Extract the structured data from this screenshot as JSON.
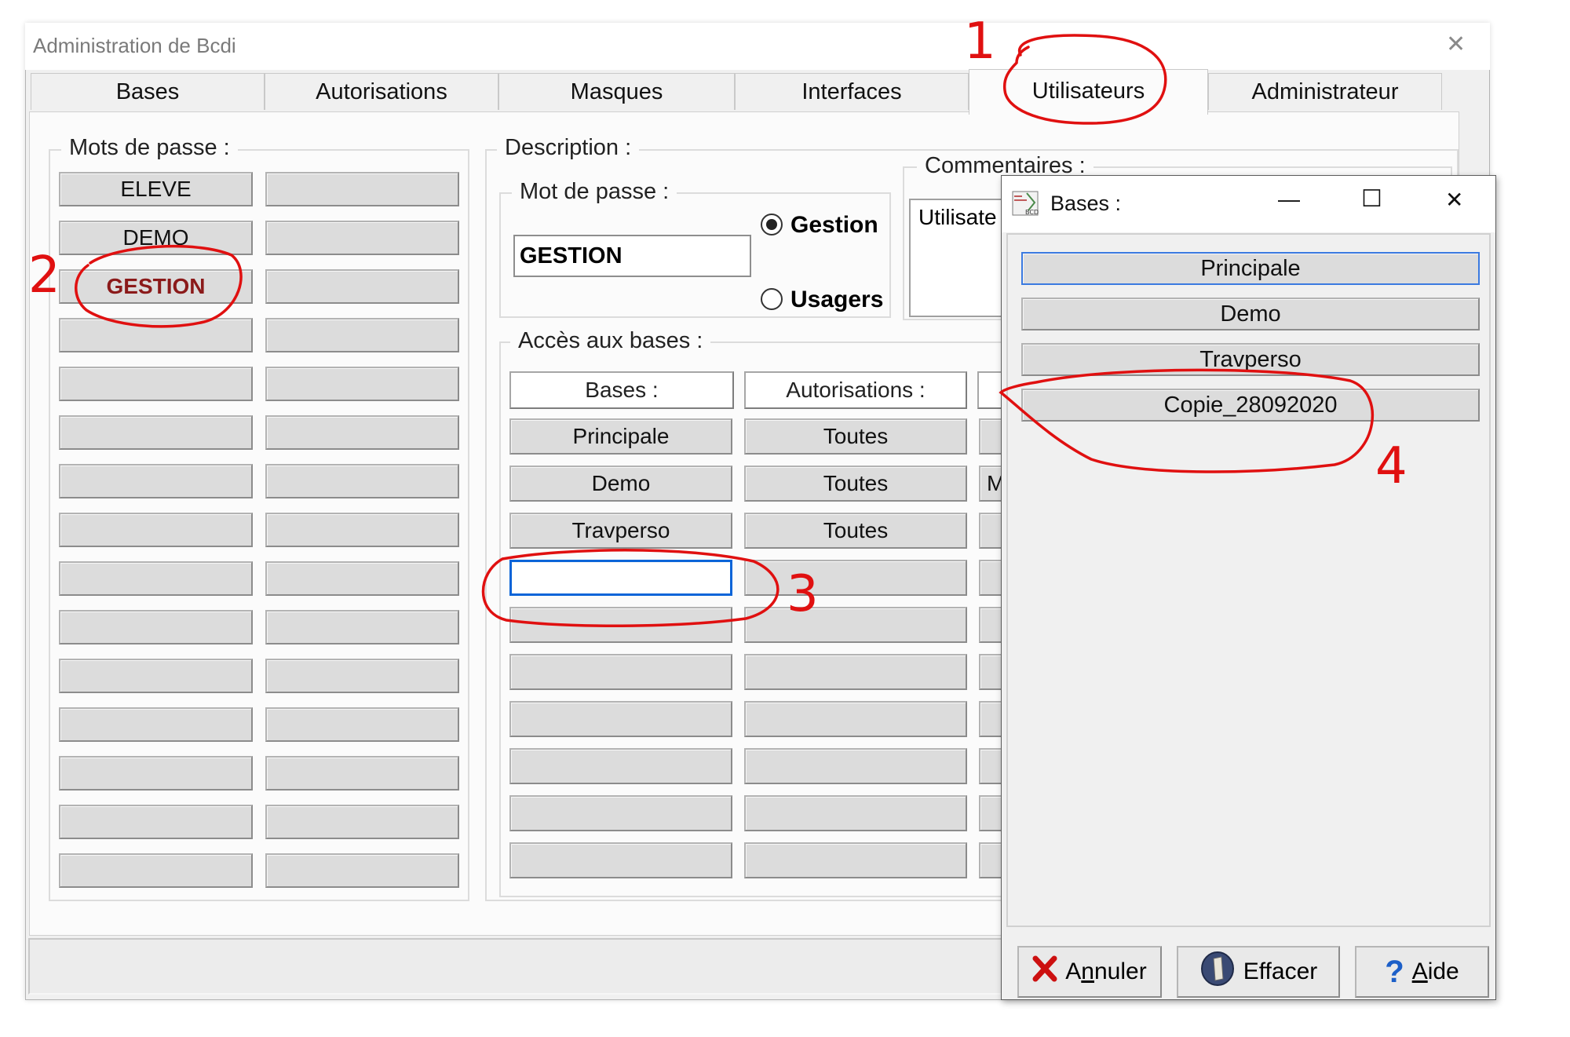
{
  "window": {
    "title": "Administration de Bcdi",
    "close_glyph": "✕"
  },
  "tabs": [
    {
      "label": "Bases"
    },
    {
      "label": "Autorisations"
    },
    {
      "label": "Masques"
    },
    {
      "label": "Interfaces"
    },
    {
      "label": "Utilisateurs",
      "active": true
    },
    {
      "label": "Administrateur"
    }
  ],
  "passwords": {
    "legend": "Mots de passe :",
    "col1": [
      "ELEVE",
      "DEMO",
      "GESTION",
      "",
      "",
      "",
      "",
      "",
      "",
      "",
      "",
      "",
      "",
      "",
      ""
    ],
    "col2": [
      "",
      "",
      "",
      "",
      "",
      "",
      "",
      "",
      "",
      "",
      "",
      "",
      "",
      "",
      ""
    ]
  },
  "description": {
    "legend": "Description :",
    "password_legend": "Mot de passe :",
    "password_value": "GESTION",
    "radio_gestion": "Gestion",
    "radio_usagers": "Usagers",
    "comments_legend": "Commentaires :",
    "comments_text": "Utilisate"
  },
  "access": {
    "legend": "Accès aux bases :",
    "headers": [
      "Bases :",
      "Autorisations :"
    ],
    "rows": [
      {
        "base": "Principale",
        "auth": "Toutes",
        "c3": ""
      },
      {
        "base": "Demo",
        "auth": "Toutes",
        "c3": "M"
      },
      {
        "base": "Travperso",
        "auth": "Toutes",
        "c3": ""
      },
      {
        "base": "",
        "auth": "",
        "c3": ""
      },
      {
        "base": "",
        "auth": "",
        "c3": ""
      },
      {
        "base": "",
        "auth": "",
        "c3": ""
      },
      {
        "base": "",
        "auth": "",
        "c3": ""
      },
      {
        "base": "",
        "auth": "",
        "c3": ""
      },
      {
        "base": "",
        "auth": "",
        "c3": ""
      },
      {
        "base": "",
        "auth": "",
        "c3": ""
      }
    ]
  },
  "bases_dialog": {
    "title": "Bases :",
    "icon_text": "BCDI",
    "minimize": "—",
    "maximize": "☐",
    "close": "✕",
    "items": [
      "Principale",
      "Demo",
      "Travperso",
      "Copie_28092020"
    ],
    "buttons": {
      "cancel": "Annuler",
      "clear": "Effacer",
      "help": "Aide"
    },
    "cancel_mnemonic": "n",
    "help_mnemonic": "A"
  },
  "annotations": [
    "1",
    "2",
    "3",
    "4"
  ],
  "colors": {
    "annotation": "#e01010",
    "selected_text": "#8b1a1a",
    "focus": "#0a64d8"
  }
}
